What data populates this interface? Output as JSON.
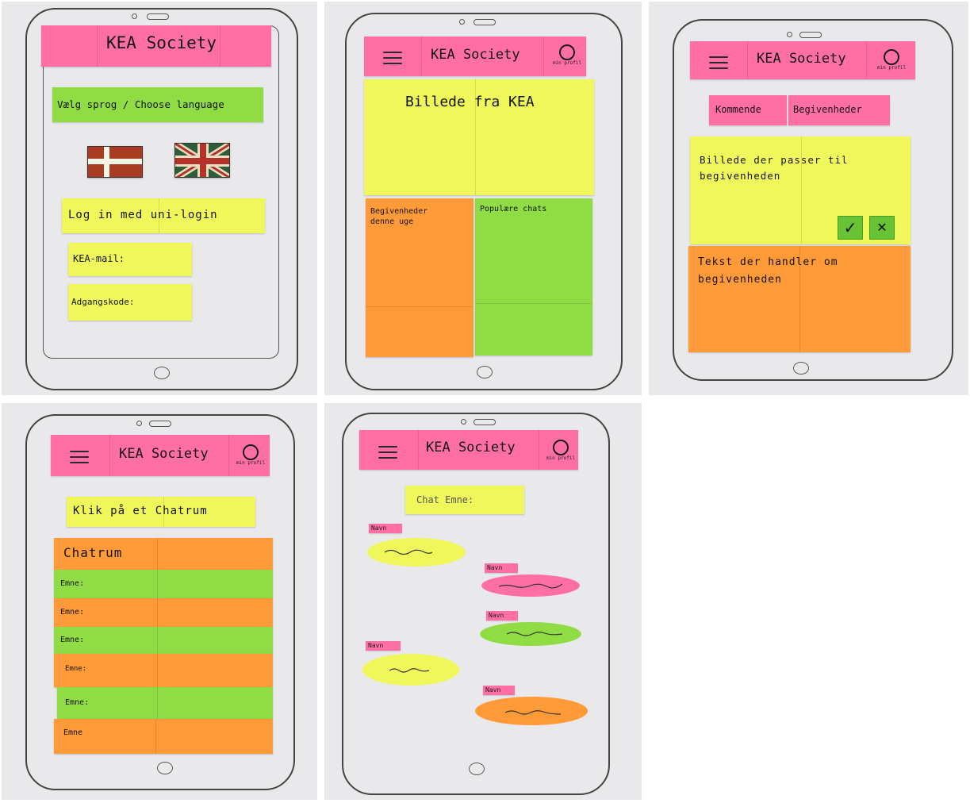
{
  "app_title": "KEA Society",
  "profile_label": "min profil",
  "screen1": {
    "language_prompt": "Vælg sprog / Choose language",
    "flags": [
      "danish-flag-icon",
      "british-flag-icon"
    ],
    "login_label": "Log in med uni-login",
    "email_label": "KEA-mail:",
    "password_label": "Adgangskode:"
  },
  "screen2": {
    "image_placeholder": "Billede fra KEA",
    "events_label": "Begivenheder denne uge",
    "chats_label": "Populære chats"
  },
  "screen3": {
    "tab_upcoming": "Kommende",
    "tab_events": "Begivenheder",
    "image_text": "Billede der passer til begivenheden",
    "accept_symbol": "✓",
    "decline_symbol": "✕",
    "description_text": "Tekst der handler om begivenheden"
  },
  "screen4": {
    "instruction": "Klik på et Chatrum",
    "header": "Chatrum",
    "rows": [
      "Emne:",
      "Emne:",
      "Emne:",
      "Emne:",
      "Emne:",
      "Emne"
    ]
  },
  "screen5": {
    "topic_label": "Chat Emne:",
    "messages": [
      {
        "name": "Navn",
        "color": "yellow"
      },
      {
        "name": "Navn",
        "color": "pink"
      },
      {
        "name": "Navn",
        "color": "green"
      },
      {
        "name": "Navn",
        "color": "yellow"
      },
      {
        "name": "Navn",
        "color": "orange"
      }
    ]
  },
  "colors": {
    "pink": "#ff6fa3",
    "yellow": "#eff75a",
    "green": "#8fdc45",
    "orange": "#ff9a38",
    "paper": "#e9e9eb"
  }
}
